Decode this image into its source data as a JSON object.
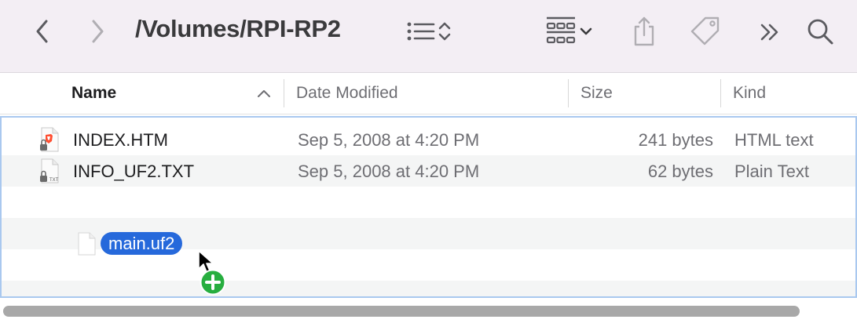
{
  "window": {
    "path_title": "/Volumes/RPI-RP2"
  },
  "toolbar": {
    "back_icon": "chevron-left-icon",
    "forward_icon": "chevron-right-icon",
    "list_view_icon": "list-view-icon",
    "sort_toggle_icon": "chevron-updown-icon",
    "group_icon": "grid-group-icon",
    "group_menu_icon": "chevron-down-icon",
    "share_icon": "share-icon",
    "tag_icon": "tag-icon",
    "overflow_icon": "double-chevron-right-icon",
    "search_icon": "search-icon"
  },
  "columns": {
    "name": "Name",
    "date_modified": "Date Modified",
    "size": "Size",
    "kind": "Kind"
  },
  "files": [
    {
      "name": "INDEX.HTM",
      "date": "Sep 5, 2008 at 4:20 PM",
      "size": "241 bytes",
      "kind": "HTML text",
      "icon": "html-file-locked-icon"
    },
    {
      "name": "INFO_UF2.TXT",
      "date": "Sep 5, 2008 at 4:20 PM",
      "size": "62 bytes",
      "kind": "Plain Text",
      "icon": "text-file-locked-icon"
    }
  ],
  "drag_item": {
    "name": "main.uf2",
    "badge_icon": "add-copy-icon"
  },
  "colors": {
    "toolbar_bg": "#f3eef4",
    "selection_blue": "#2669db",
    "drop_target_border": "#a9c8ef",
    "copy_badge_green": "#27ae3f"
  }
}
